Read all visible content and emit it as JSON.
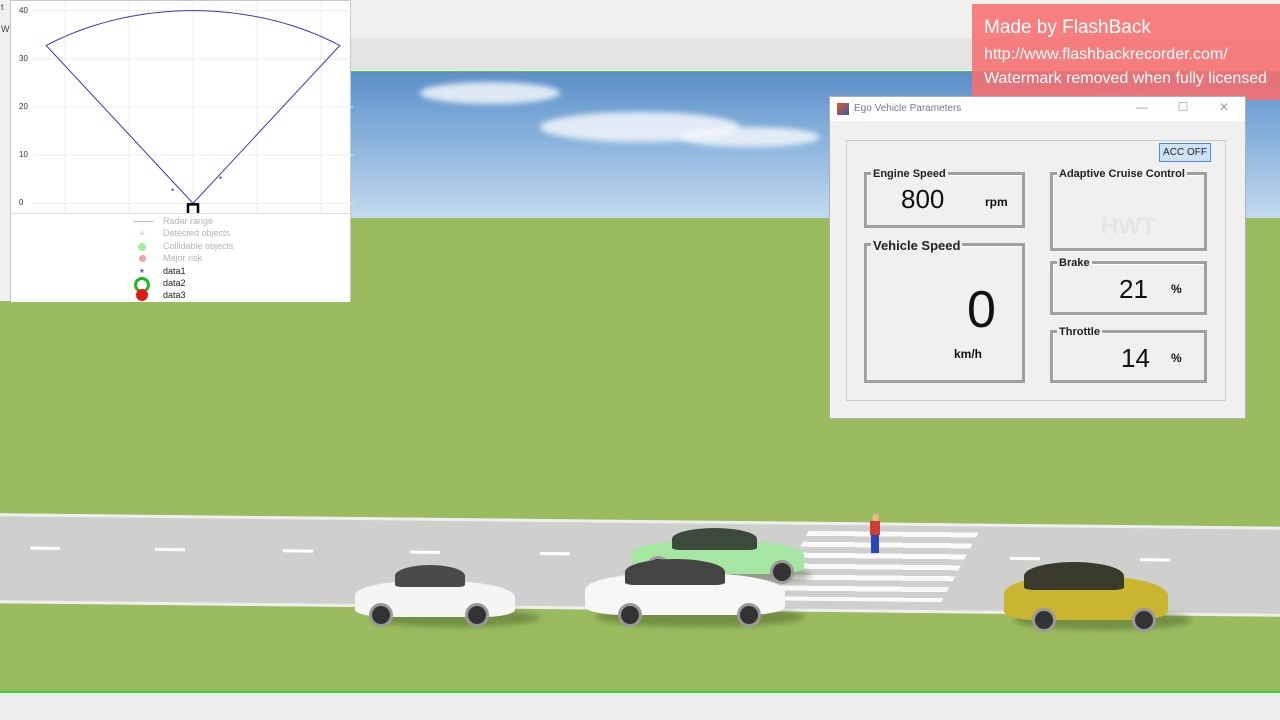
{
  "radar": {
    "left_panel_labels": [
      "t",
      "W"
    ],
    "y_ticks": [
      "40",
      "30",
      "20",
      "10",
      "0"
    ],
    "legend": [
      {
        "marker": "line-gray",
        "label": "Radar range",
        "color": "#bdbdbd"
      },
      {
        "marker": "plus",
        "label": "Detected objects",
        "color": "#9fd3f5"
      },
      {
        "marker": "circle-green",
        "label": "Collidable objects",
        "color": "#a6e8a6"
      },
      {
        "marker": "dot-red",
        "label": "Major risk",
        "color": "#f5a0a0"
      },
      {
        "marker": "star-blue",
        "label": "data1",
        "color": "#3a3ab0"
      },
      {
        "marker": "ring-green",
        "label": "data2",
        "color": "#1fb81f"
      },
      {
        "marker": "dot-red-solid",
        "label": "data3",
        "color": "#e01b1b"
      }
    ],
    "detections": [
      {
        "x": -3,
        "y": 2.5
      },
      {
        "x": 4.5,
        "y": 5
      }
    ]
  },
  "watermark": {
    "line1": "Made by FlashBack",
    "line2": "http://www.flashbackrecorder.com/",
    "line3": "Watermark removed when fully licensed"
  },
  "ego": {
    "title": "Ego Vehicle Parameters",
    "minimize": "—",
    "maximize": "☐",
    "close": "✕",
    "acc_button": "ACC OFF",
    "engine_speed": {
      "label": "Engine Speed",
      "value": "800",
      "unit": "rpm"
    },
    "vehicle_speed": {
      "label": "Vehicle Speed",
      "value": "0",
      "unit": "km/h"
    },
    "acc": {
      "label": "Adaptive Cruise Control",
      "ghost_text": "HWT"
    },
    "brake": {
      "label": "Brake",
      "value": "21",
      "unit": "%"
    },
    "throttle": {
      "label": "Throttle",
      "value": "14",
      "unit": "%"
    }
  },
  "colors": {
    "radar_line": "#3a3ab0",
    "accent_green": "#39d23a",
    "watermark_bg": "#f76e6e"
  }
}
